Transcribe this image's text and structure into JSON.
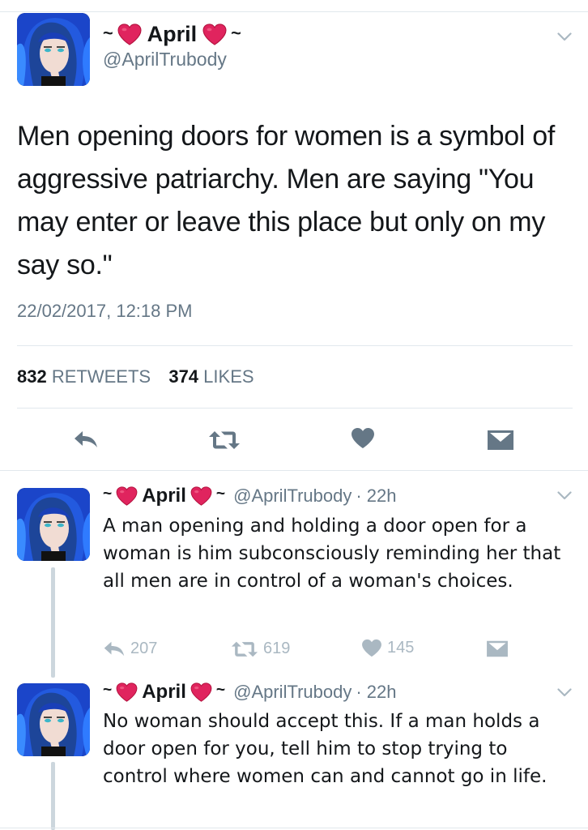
{
  "colors": {
    "text": "#14171a",
    "secondary": "#657786",
    "action_gray": "#aab8c2",
    "heart_red": "#e0245e",
    "divider": "#e1e8ed"
  },
  "main_tweet": {
    "name_prefix": "~",
    "name": "April",
    "name_suffix": "~",
    "handle": "@AprilTrubody",
    "text": "Men opening doors for women is a symbol of aggressive patriarchy. Men are saying \"You may enter or leave this place but only on my say so.\"",
    "timestamp": "22/02/2017, 12:18 PM",
    "retweets_count": "832",
    "retweets_label": "RETWEETS",
    "likes_count": "374",
    "likes_label": "LIKES",
    "actions": [
      "reply-icon",
      "retweet-icon",
      "like-icon",
      "direct-message-icon"
    ]
  },
  "replies": [
    {
      "name_prefix": "~",
      "name": "April",
      "name_suffix": "~",
      "handle": "@AprilTrubody",
      "time": "· 22h",
      "text": "A man opening and holding a door open for a woman is him subconsciously reminding her that all men are in control of a woman's choices.",
      "reply_count": "207",
      "retweet_count": "619",
      "like_count": "145"
    },
    {
      "name_prefix": "~",
      "name": "April",
      "name_suffix": "~",
      "handle": "@AprilTrubody",
      "time": "· 22h",
      "text": "No woman should accept this. If a man holds a door open for you, tell him to stop trying to control where women can and cannot go in life."
    }
  ]
}
